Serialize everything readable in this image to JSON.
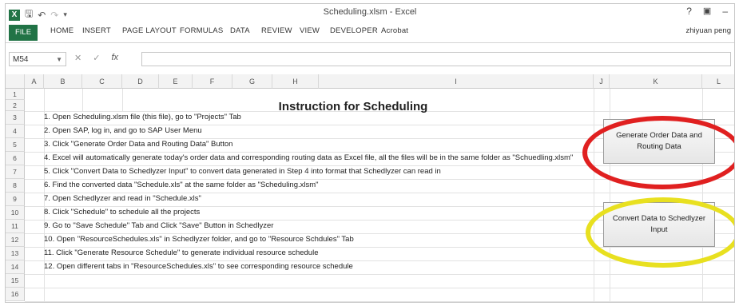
{
  "window": {
    "title": "Scheduling.xlsm - Excel",
    "app_icon": "X",
    "help": "?",
    "minimize": "–"
  },
  "qat_icons": [
    "save-icon",
    "undo-icon",
    "redo-icon",
    "customize-icon"
  ],
  "ribbon": {
    "file": "FILE",
    "tabs": [
      "HOME",
      "INSERT",
      "PAGE LAYOUT",
      "FORMULAS",
      "DATA",
      "REVIEW",
      "VIEW",
      "DEVELOPER",
      "Acrobat"
    ],
    "user": "zhiyuan peng"
  },
  "formula_bar": {
    "name_box": "M54",
    "fx": "fx",
    "cancel": "✕",
    "enter": "✓",
    "value": ""
  },
  "columns": [
    "A",
    "B",
    "C",
    "D",
    "E",
    "F",
    "G",
    "H",
    "I",
    "J",
    "K",
    "L"
  ],
  "rows": [
    "1",
    "2",
    "3",
    "4",
    "5",
    "6",
    "7",
    "8",
    "9",
    "10",
    "11",
    "12",
    "13",
    "14",
    "15",
    "16"
  ],
  "sheet": {
    "title": "Instruction for Scheduling",
    "instructions": [
      "1. Open Scheduling.xlsm file (this file), go to \"Projects\" Tab",
      "2. Open SAP, log in, and go to SAP User Menu",
      "3. Click \"Generate Order Data and Routing Data\" Button",
      "4. Excel will automatically generate today's order data and corresponding routing data as Excel file, all the files will be in the same folder as \"Schuedling.xlsm\"",
      "5. Click \"Convert Data to Schedlyzer Input\" to convert data generated in Step 4 into format that Schedlyzer can read in",
      "6. Find the converted data \"Schedule.xls\" at the same folder as \"Scheduling.xlsm\"",
      "7. Open Schedlyzer and read in \"Schedule.xls\"",
      "8. Click \"Schedule\" to schedule all the projects",
      "9. Go to \"Save Schedule\" Tab and Click \"Save\" Button in Schedlyzer",
      "10. Open \"ResourceSchedules.xls\" in Schedlyzer folder, and go to \"Resource Schdules\" Tab",
      "11. Click \"Generate Resource Schedule\" to generate individual resource schedule",
      "12. Open different tabs in \"ResourceSchedules.xls\" to see corresponding resource schedule"
    ],
    "buttons": {
      "generate": "Generate Order Data and Routing Data",
      "convert": "Convert Data to Schedlyzer Input"
    }
  },
  "colors": {
    "excel_green": "#217346",
    "ring_red": "#e02020",
    "ring_yellow": "#e8e020"
  }
}
